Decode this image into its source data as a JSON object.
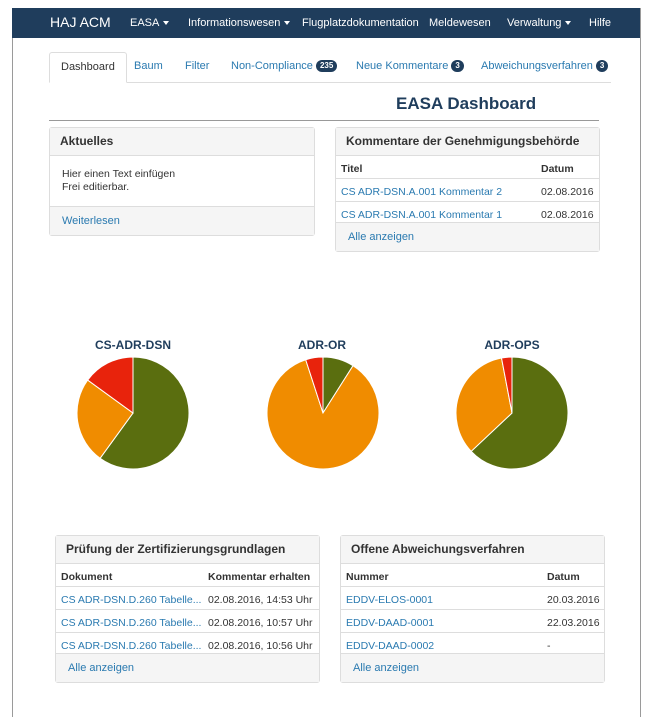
{
  "navbar": {
    "brand": "HAJ ACM",
    "items": [
      {
        "label": "EASA",
        "dropdown": true
      },
      {
        "label": "Informationswesen",
        "dropdown": true
      },
      {
        "label": "Flugplatzdokumentation",
        "dropdown": false
      },
      {
        "label": "Meldewesen",
        "dropdown": false
      },
      {
        "label": "Verwaltung",
        "dropdown": true
      },
      {
        "label": "Hilfe",
        "dropdown": false
      }
    ]
  },
  "tabs": [
    {
      "label": "Dashboard",
      "active": true
    },
    {
      "label": "Baum"
    },
    {
      "label": "Filter"
    },
    {
      "label": "Non-Compliance",
      "badge": "235"
    },
    {
      "label": "Neue Kommentare",
      "badge": "3"
    },
    {
      "label": "Abweichungsverfahren",
      "badge": "3"
    }
  ],
  "page_title": "EASA Dashboard",
  "aktuelles": {
    "title": "Aktuelles",
    "line1": "Hier einen Text einfügen",
    "line2": "Frei editierbar.",
    "footer_link": "Weiterlesen"
  },
  "kommentare": {
    "title": "Kommentare der Genehmigungsbehörde",
    "col_titel": "Titel",
    "col_datum": "Datum",
    "rows": [
      {
        "titel": "CS ADR-DSN.A.001 Kommentar 2",
        "datum": "02.08.2016"
      },
      {
        "titel": "CS ADR-DSN.A.001 Kommentar 1",
        "datum": "02.08.2016"
      }
    ],
    "footer_link": "Alle anzeigen"
  },
  "charts": [
    {
      "title": "CS-ADR-DSN"
    },
    {
      "title": "ADR-OR"
    },
    {
      "title": "ADR-OPS"
    }
  ],
  "chart_data": [
    {
      "type": "pie",
      "title": "CS-ADR-DSN",
      "values": [
        60,
        25,
        15
      ],
      "colors": [
        "#5a6e0f",
        "#f08c00",
        "#e8230c"
      ]
    },
    {
      "type": "pie",
      "title": "ADR-OR",
      "values": [
        9,
        86,
        5
      ],
      "colors": [
        "#5a6e0f",
        "#f08c00",
        "#e8230c"
      ]
    },
    {
      "type": "pie",
      "title": "ADR-OPS",
      "values": [
        63,
        34,
        3
      ],
      "colors": [
        "#5a6e0f",
        "#f08c00",
        "#e8230c"
      ]
    }
  ],
  "pruefung": {
    "title": "Prüfung der Zertifizierungsgrundlagen",
    "col_dokument": "Dokument",
    "col_kommentar": "Kommentar erhalten",
    "rows": [
      {
        "dokument": "CS ADR-DSN.D.260 Tabelle...",
        "kommentar": "02.08.2016, 14:53 Uhr"
      },
      {
        "dokument": "CS ADR-DSN.D.260 Tabelle...",
        "kommentar": "02.08.2016, 10:57 Uhr"
      },
      {
        "dokument": "CS ADR-DSN.D.260 Tabelle...",
        "kommentar": "02.08.2016, 10:56 Uhr"
      }
    ],
    "footer_link": "Alle anzeigen"
  },
  "abweichung": {
    "title": "Offene Abweichungsverfahren",
    "col_nummer": "Nummer",
    "col_datum": "Datum",
    "rows": [
      {
        "nummer": "EDDV-ELOS-0001",
        "datum": "20.03.2016"
      },
      {
        "nummer": "EDDV-DAAD-0001",
        "datum": "22.03.2016"
      },
      {
        "nummer": "EDDV-DAAD-0002",
        "datum": "-"
      }
    ],
    "footer_link": "Alle anzeigen"
  }
}
